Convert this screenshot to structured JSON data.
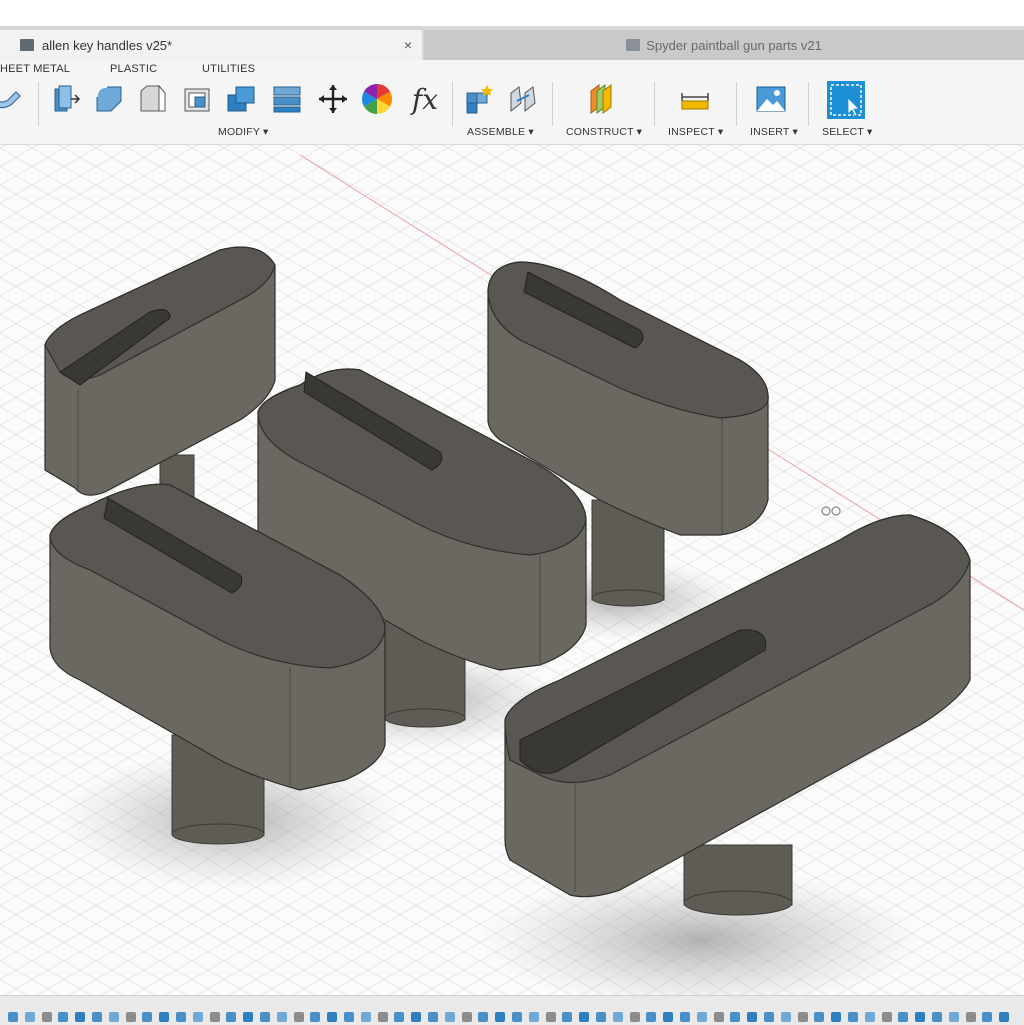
{
  "tabs": {
    "active": {
      "title": "allen key handles v25*",
      "close": "×"
    },
    "inactive": {
      "title": "Spyder paintball gun parts v21"
    }
  },
  "ribbon": {
    "workspace_tabs": [
      "HEET METAL",
      "PLASTIC",
      "UTILITIES"
    ],
    "groups": {
      "modify": "MODIFY ▾",
      "assemble": "ASSEMBLE ▾",
      "construct": "CONSTRUCT ▾",
      "inspect": "INSPECT ▾",
      "insert": "INSERT ▾",
      "select": "SELECT ▾"
    },
    "fx_label": "fx"
  },
  "icons": [
    "sheet-metal-icon",
    "press-pull-icon",
    "fillet-icon",
    "chamfer-icon",
    "shell-icon",
    "combine-icon",
    "stack-icon",
    "move-icon",
    "appearance-icon",
    "parameters-icon",
    "new-component-icon",
    "joint-icon",
    "construct-plane-icon",
    "measure-icon",
    "insert-image-icon",
    "select-icon"
  ],
  "colors": {
    "accent": "#1c8fd6",
    "body": "#6b6861",
    "grid": "#d8d8d8"
  }
}
